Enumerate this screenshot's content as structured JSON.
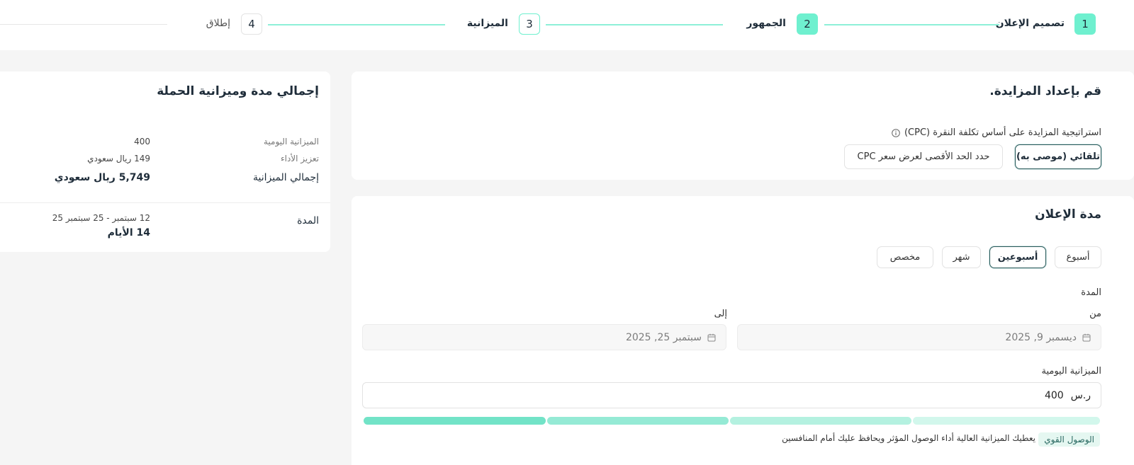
{
  "stepper": {
    "steps": [
      {
        "num": "1",
        "label": "تصميم الإعلان"
      },
      {
        "num": "2",
        "label": "الجمهور"
      },
      {
        "num": "3",
        "label": "الميزانية"
      },
      {
        "num": "4",
        "label": "إطلاق"
      }
    ]
  },
  "bidding": {
    "title": "قم بإعداد المزايدة.",
    "strategy_label": "استراتيجية المزايدة على أساس تكلفة النقرة (CPC)",
    "options": [
      "تلقائي (موصى به)",
      "حدد الحد الأقصى لعرض سعر CPC"
    ]
  },
  "duration": {
    "title": "مدة الإعلان",
    "presets": [
      "أسبوع",
      "أسبوعين",
      "شهر",
      "مخصص"
    ],
    "period_label": "المدة",
    "from_label": "من",
    "to_label": "إلى",
    "from_value": "ديسمبر 9, 2025",
    "to_value": "سبتمبر 25, 2025",
    "daily_budget_label": "الميزانية اليومية",
    "currency": "ر.س",
    "daily_budget_value": "400",
    "reach_badge": "الوصول القوي",
    "reach_note": "يعطيك الميزانية العالية أداء الوصول المؤثر ويحافظ عليك أمام المنافسين"
  },
  "summary": {
    "title": "إجمالي مدة وميزانية الحملة",
    "daily_budget_label": "الميزانية اليومية",
    "daily_budget_value": "400",
    "boost_label": "تعزيز الأداء",
    "boost_value": "149 ريال سعودي",
    "total_label": "إجمالي الميزانية",
    "total_value": "5,749 ريال سعودي",
    "duration_label": "المدة",
    "duration_range": "12 سبتمبر - 25 سبتمبر 25",
    "duration_days": "14 الأيام"
  },
  "colors": {
    "accent": "#6ff0cf",
    "selected_border": "#2b5a5a",
    "seg1": "#d2f7ec",
    "seg2": "#b4f1e0",
    "seg3": "#95ead5",
    "seg4": "#72e3c7"
  }
}
